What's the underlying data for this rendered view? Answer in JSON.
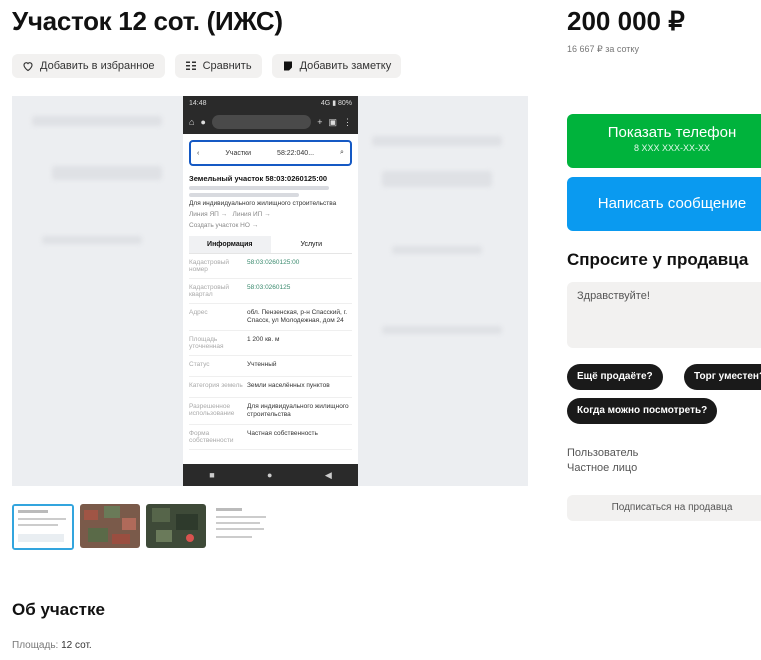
{
  "listing": {
    "title": "Участок 12 сот. (ИЖС)",
    "actions": {
      "favorite": "Добавить в избранное",
      "compare": "Сравнить",
      "note": "Добавить заметку"
    },
    "gallery": {
      "phone_status_time": "14:48",
      "phone_status_right": "4G ▮ 80%",
      "phone_search_left": "Участки",
      "phone_search_value": "58:22:040...",
      "phone_record_title": "Земельный участок 58:03:0260125:00",
      "phone_category": "Для индивидуального жилищного строительства",
      "phone_link1": "Линия ЯП →",
      "phone_link2": "Линия ИП →",
      "phone_link3": "Создать участок НО →",
      "phone_tab_info": "Информация",
      "phone_tab_services": "Услуги",
      "phone_rows": [
        {
          "k": "Кадастровый номер",
          "v": "58:03:0260125:00",
          "link": true
        },
        {
          "k": "Кадастровый квартал",
          "v": "58:03:0260125",
          "link": true
        },
        {
          "k": "Адрес",
          "v": "обл. Пензенская, р-н Спасский, г. Спасск, ул Молодежная, дом 24",
          "link": false
        },
        {
          "k": "Площадь уточненная",
          "v": "1 200 кв. м",
          "link": false
        },
        {
          "k": "Статус",
          "v": "Учтенный",
          "link": false
        },
        {
          "k": "Категория земель",
          "v": "Земли населённых пунктов",
          "link": false
        },
        {
          "k": "Разрешенное использование",
          "v": "Для индивидуального жилищного строительства",
          "link": false
        },
        {
          "k": "Форма собственности",
          "v": "Частная собственность",
          "link": false
        }
      ]
    },
    "about": {
      "heading": "Об участке",
      "area_label": "Площадь:",
      "area_value": "12 сот."
    }
  },
  "sidebar": {
    "price": "200 000 ₽",
    "price_per_unit": "16 667 ₽ за сотку",
    "show_phone_label": "Показать телефон",
    "show_phone_masked": "8 XXX XXX-XX-XX",
    "write_message_label": "Написать сообщение",
    "ask_heading": "Спросите у продавца",
    "message_text": "Здравствуйте!",
    "chips": [
      "Ещё продаёте?",
      "Торг уместен?",
      "Когда можно посмотреть?"
    ],
    "seller_role": "Пользователь",
    "seller_type": "Частное лицо",
    "subscribe_label": "Подписаться на продавца"
  },
  "colors": {
    "green": "#00b33c",
    "blue": "#0a9af0",
    "chip": "#1a1a1a",
    "thumb_selected": "#33a5de"
  }
}
